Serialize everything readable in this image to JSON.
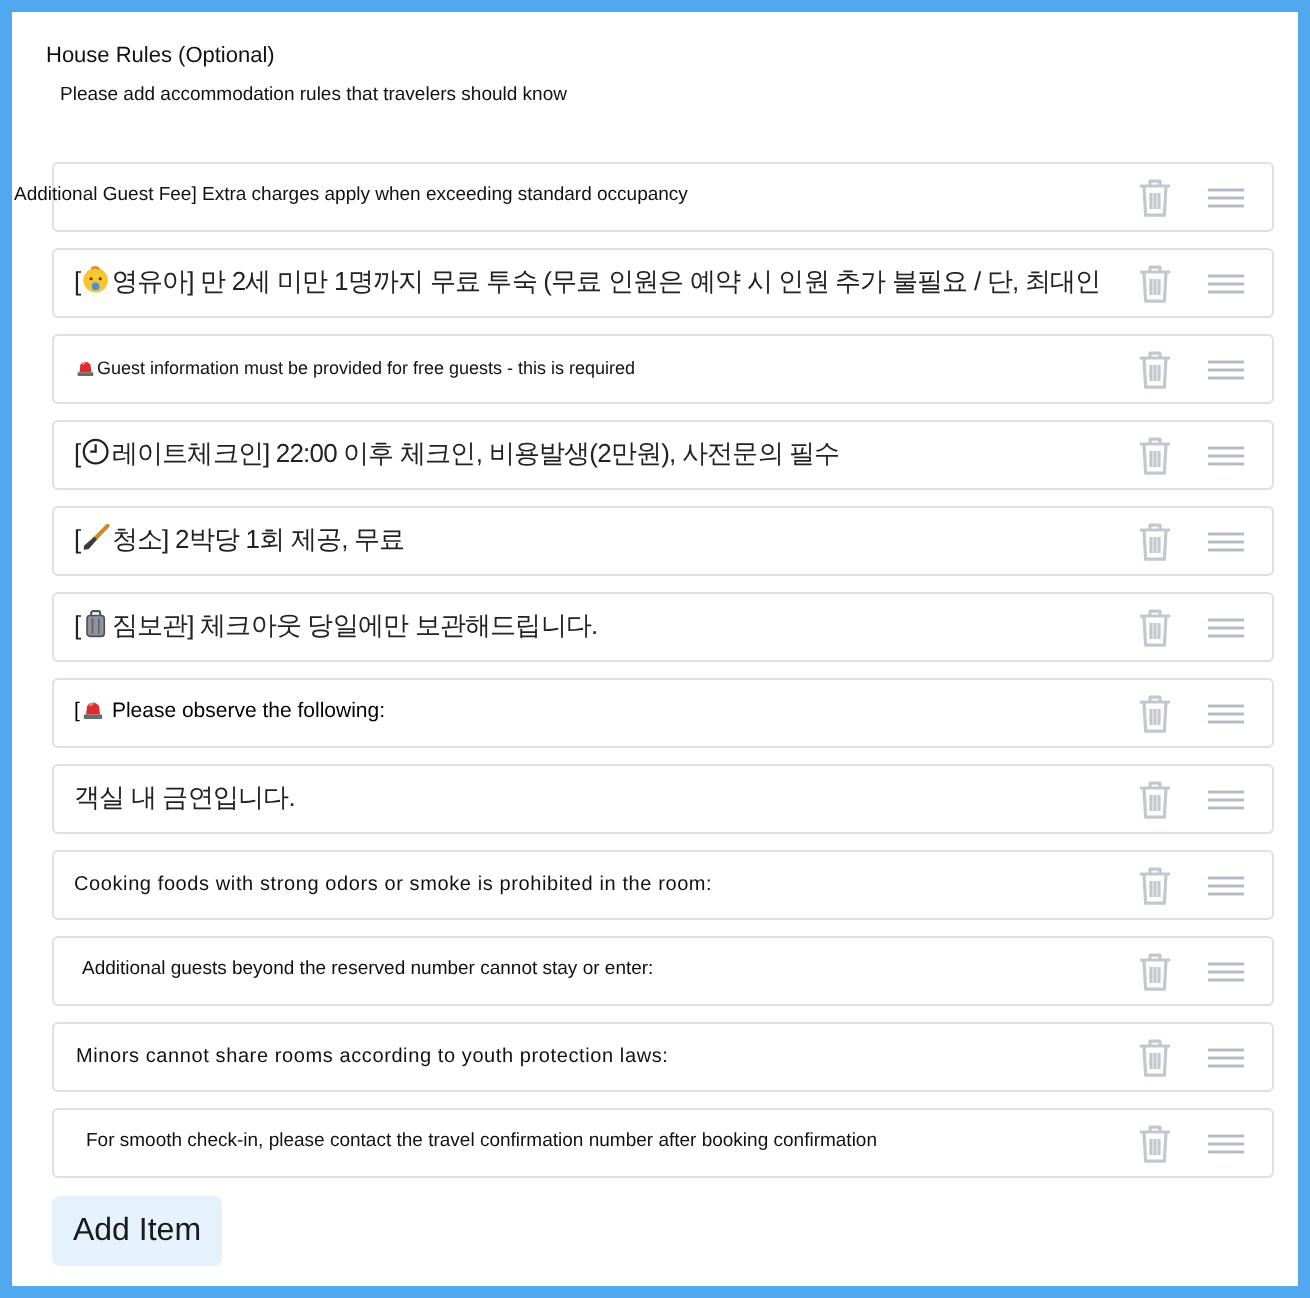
{
  "form": {
    "title": "House Rules (Optional)",
    "subtitle": "Please add accommodation rules that travelers should know"
  },
  "rules": [
    {
      "kind": "plain",
      "text": "Additional Guest Fee] Extra charges apply when exceeding standard occupancy"
    },
    {
      "kind": "baby",
      "lead": "[",
      "text": "영유아] 만 2세 미만 1명까지 무료 투숙 (무료 인원은 예약 시 인원 추가 불필요 / 단, 최대인"
    },
    {
      "kind": "siren",
      "text": "Guest information must be provided for free guests - this is required"
    },
    {
      "kind": "clock",
      "lead": "[",
      "text": "레이트체크인] 22:00 이후 체크인, 비용발생(2만원), 사전문의 필수"
    },
    {
      "kind": "brush",
      "lead": "[",
      "text": "청소] 2박당 1회 제공, 무료"
    },
    {
      "kind": "luggage",
      "lead": "[",
      "text": "짐보관] 체크아웃 당일에만 보관해드립니다."
    },
    {
      "kind": "siren",
      "lead": "[",
      "text": "Please observe the following:"
    },
    {
      "kind": "plain",
      "text": "객실 내 금연입니다."
    },
    {
      "kind": "plain",
      "text": "Cooking foods with strong odors or smoke is prohibited in the room:"
    },
    {
      "kind": "plain",
      "text": "Additional guests beyond the reserved number cannot stay or enter:"
    },
    {
      "kind": "plain",
      "text": "Minors cannot share rooms according to youth protection laws:"
    },
    {
      "kind": "plain",
      "text": "For smooth check-in, please contact the travel confirmation number after booking confirmation"
    }
  ],
  "add_button": {
    "label": "Add Item"
  }
}
